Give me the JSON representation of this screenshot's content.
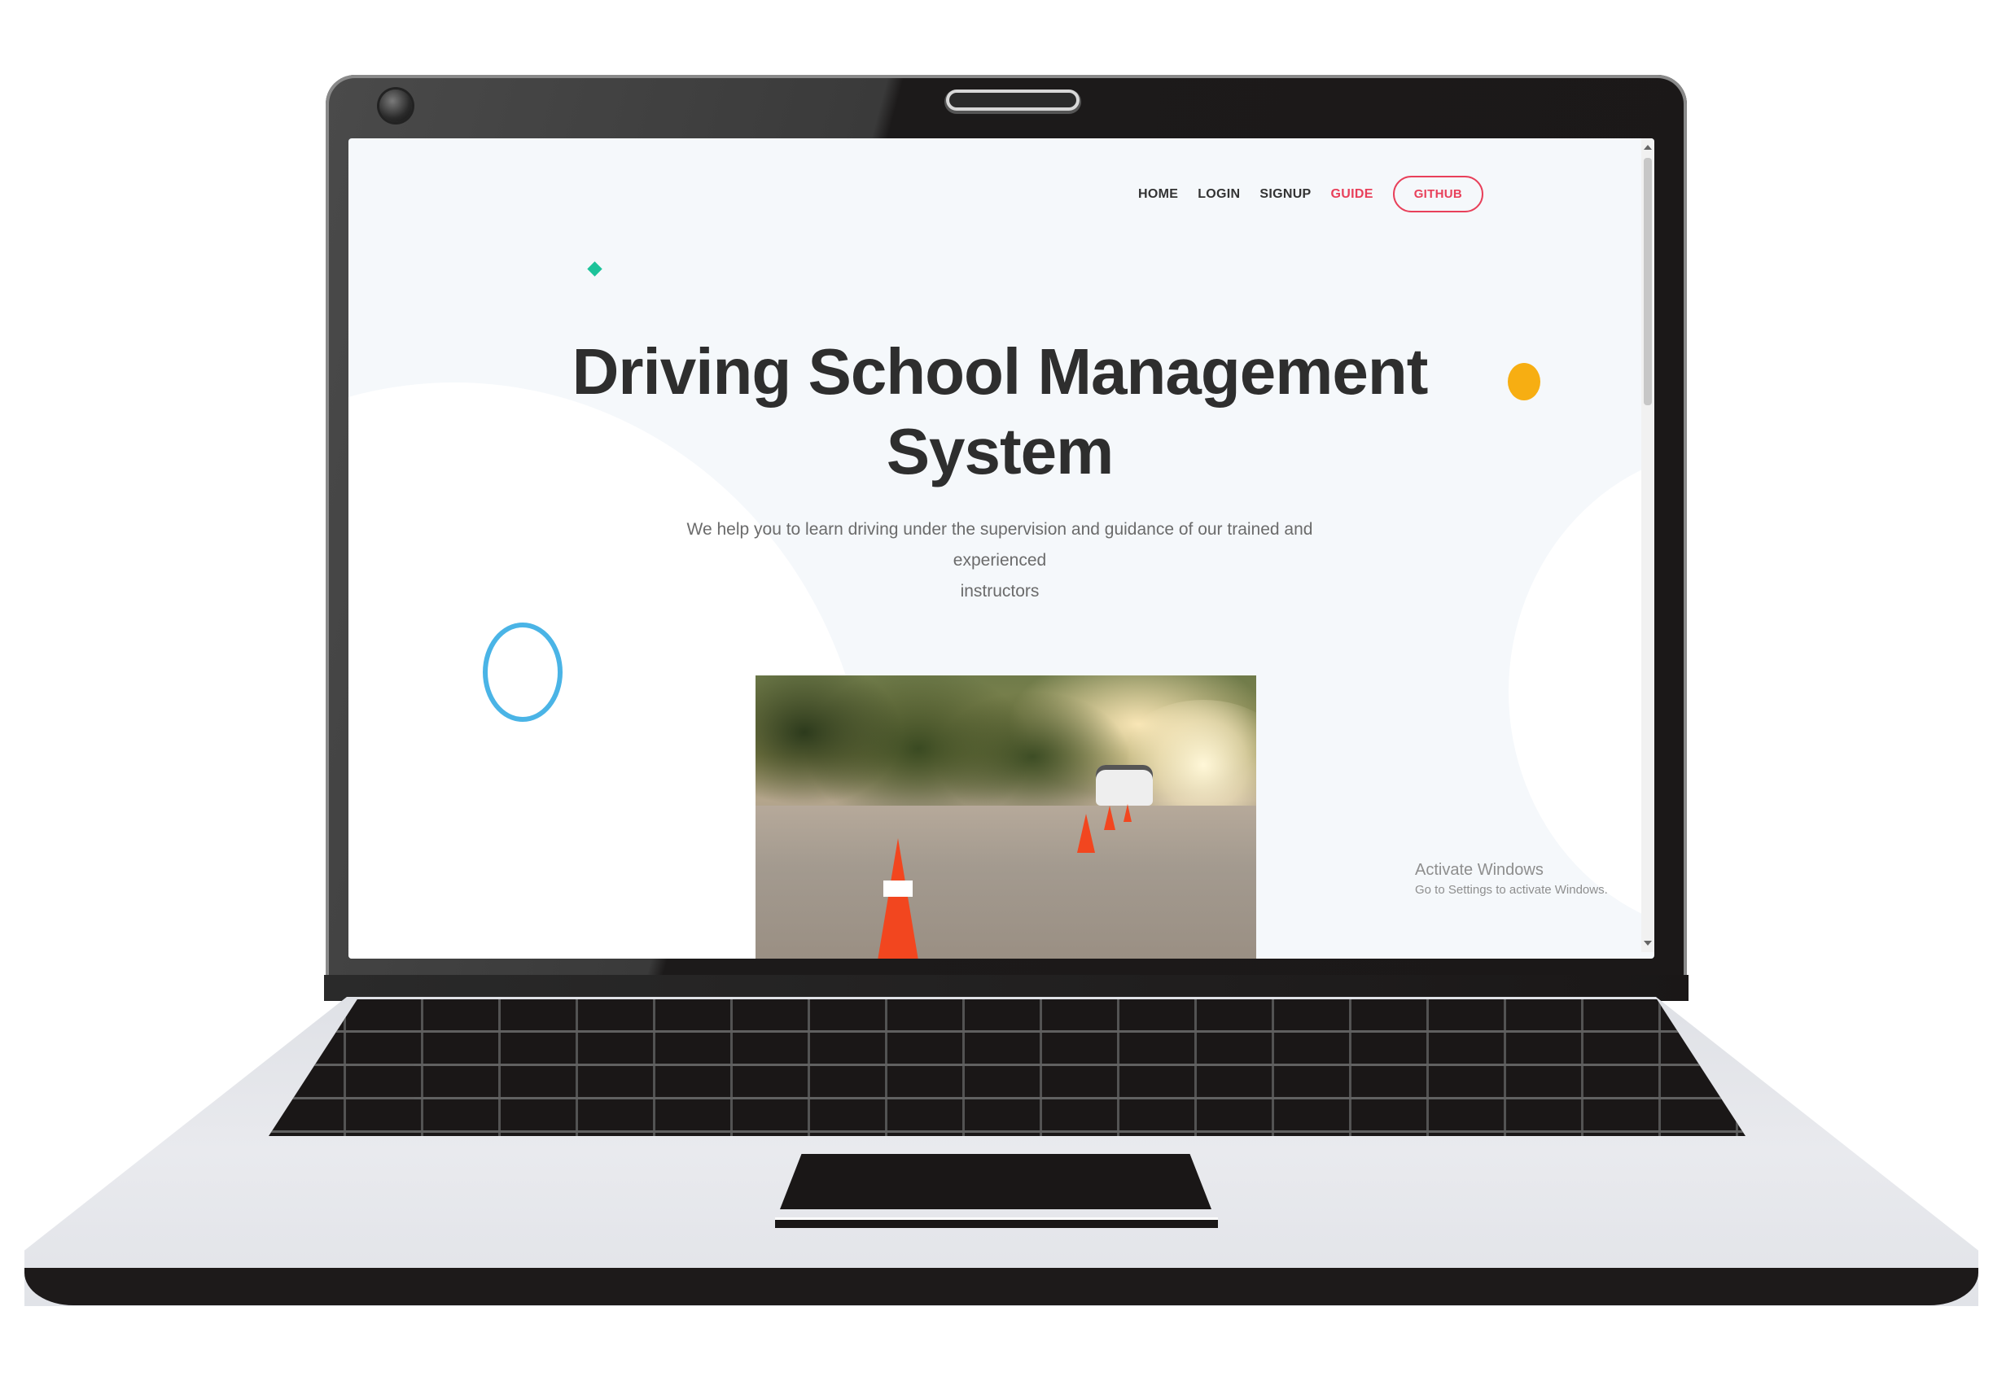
{
  "nav": {
    "items": [
      {
        "label": "HOME"
      },
      {
        "label": "LOGIN"
      },
      {
        "label": "SIGNUP"
      },
      {
        "label": "GUIDE",
        "active": true
      }
    ],
    "github_label": "GITHUB"
  },
  "hero": {
    "title_line1": "Driving School Management",
    "title_line2": "System",
    "subtitle_line1": "We help you to learn driving under the supervision and guidance of our trained and experienced",
    "subtitle_line2": "instructors"
  },
  "watermark": {
    "title": "Activate Windows",
    "subtitle": "Go to Settings to activate Windows."
  },
  "colors": {
    "accent": "#e8405a",
    "diamond": "#1cc39a",
    "yellow_dot": "#f7ae12",
    "blue_ring": "#4ab4e6",
    "page_bg": "#f5f8fb"
  }
}
